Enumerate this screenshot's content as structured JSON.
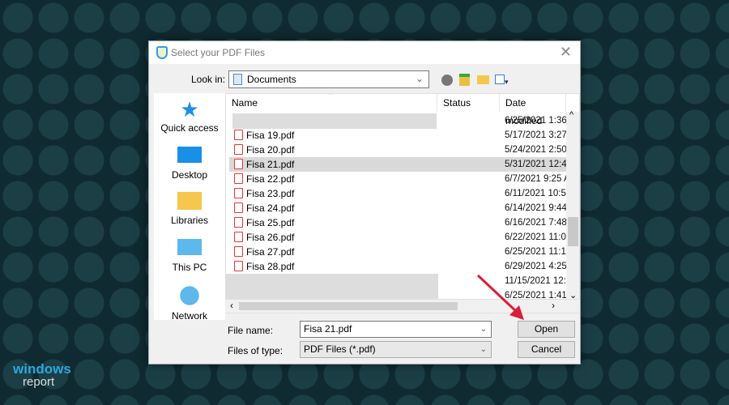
{
  "dialog": {
    "title": "Select your PDF Files",
    "close": "✕"
  },
  "lookin": {
    "label": "Look in:",
    "value": "Documents"
  },
  "places": [
    {
      "label": "Quick access"
    },
    {
      "label": "Desktop"
    },
    {
      "label": "Libraries"
    },
    {
      "label": "This PC"
    },
    {
      "label": "Network"
    }
  ],
  "columns": {
    "name": "Name",
    "status": "Status",
    "date": "Date modified"
  },
  "files": [
    {
      "name": "Fisa 19.pdf",
      "date": "5/17/2021 3:27"
    },
    {
      "name": "Fisa 20.pdf",
      "date": "5/24/2021 2:50"
    },
    {
      "name": "Fisa 21.pdf",
      "date": "5/31/2021 12:4"
    },
    {
      "name": "Fisa 22.pdf",
      "date": "6/7/2021 9:25 A"
    },
    {
      "name": "Fisa 23.pdf",
      "date": "6/11/2021 10:5"
    },
    {
      "name": "Fisa 24.pdf",
      "date": "6/14/2021 9:44"
    },
    {
      "name": "Fisa 25.pdf",
      "date": "6/16/2021 7:48"
    },
    {
      "name": "Fisa 26.pdf",
      "date": "6/22/2021 11:0"
    },
    {
      "name": "Fisa 27.pdf",
      "date": "6/25/2021 11:1"
    },
    {
      "name": "Fisa 28.pdf",
      "date": "6/29/2021 4:25"
    }
  ],
  "extra_dates": {
    "top": "6/25/2021 1:36",
    "bottom1": "11/15/2021 12:",
    "bottom2": "6/25/2021 1:41"
  },
  "filename": {
    "label": "File name:",
    "value": "Fisa 21.pdf"
  },
  "filetype": {
    "label": "Files of type:",
    "value": "PDF Files (*.pdf)"
  },
  "buttons": {
    "open": "Open",
    "cancel": "Cancel"
  },
  "watermark": {
    "line1": "windows",
    "line2": "report"
  }
}
